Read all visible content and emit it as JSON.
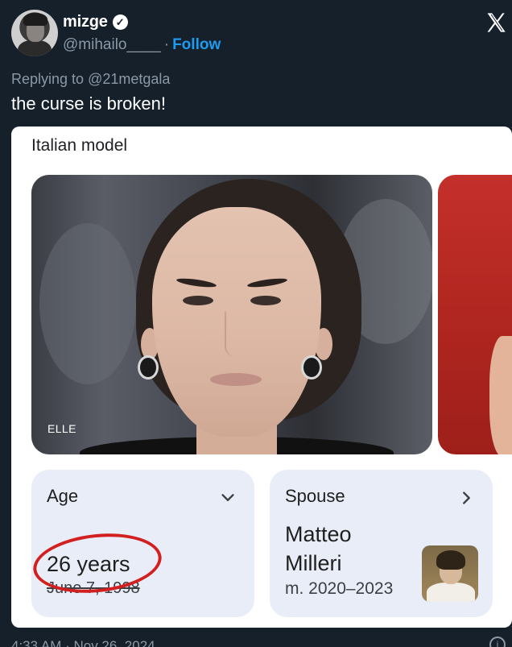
{
  "tweet": {
    "display_name": "mizge",
    "handle": "@mihailo____",
    "separator": "·",
    "follow_label": "Follow",
    "replying_prefix": "Replying to",
    "replying_to": "@21metgala",
    "text": "the curse is broken!",
    "timestamp": "4:33 AM · Nov 26, 2024"
  },
  "icons": {
    "verified": "verified-badge-icon",
    "x_logo": "x-logo-icon",
    "age_chevron": "chevron-down-icon",
    "spouse_chevron": "chevron-right-icon",
    "info": "info-icon"
  },
  "card": {
    "title": "Italian model",
    "photo_credit": "ELLE",
    "age": {
      "label": "Age",
      "value": "26 years",
      "sub": "June 7, 1998"
    },
    "spouse": {
      "label": "Spouse",
      "name": "Matteo Milleri",
      "years": "m. 2020–2023"
    }
  },
  "colors": {
    "background": "#15202b",
    "link": "#1d9bf0",
    "tile": "#e8edf7",
    "annotation": "#d21f1f"
  }
}
